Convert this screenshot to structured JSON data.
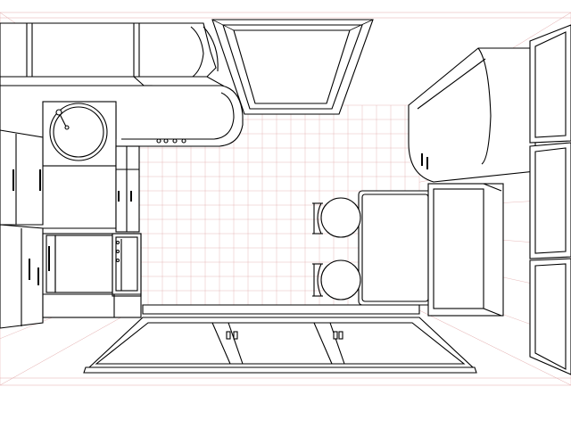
{
  "colors": {
    "grid": "#e7b9b9",
    "perspective": "#e2a9a9",
    "ink": "#000000",
    "paper": "#ffffff"
  },
  "icons": [
    "faucet-icon",
    "door-handle-icon",
    "chair-icon",
    "stove-knob-icon"
  ]
}
